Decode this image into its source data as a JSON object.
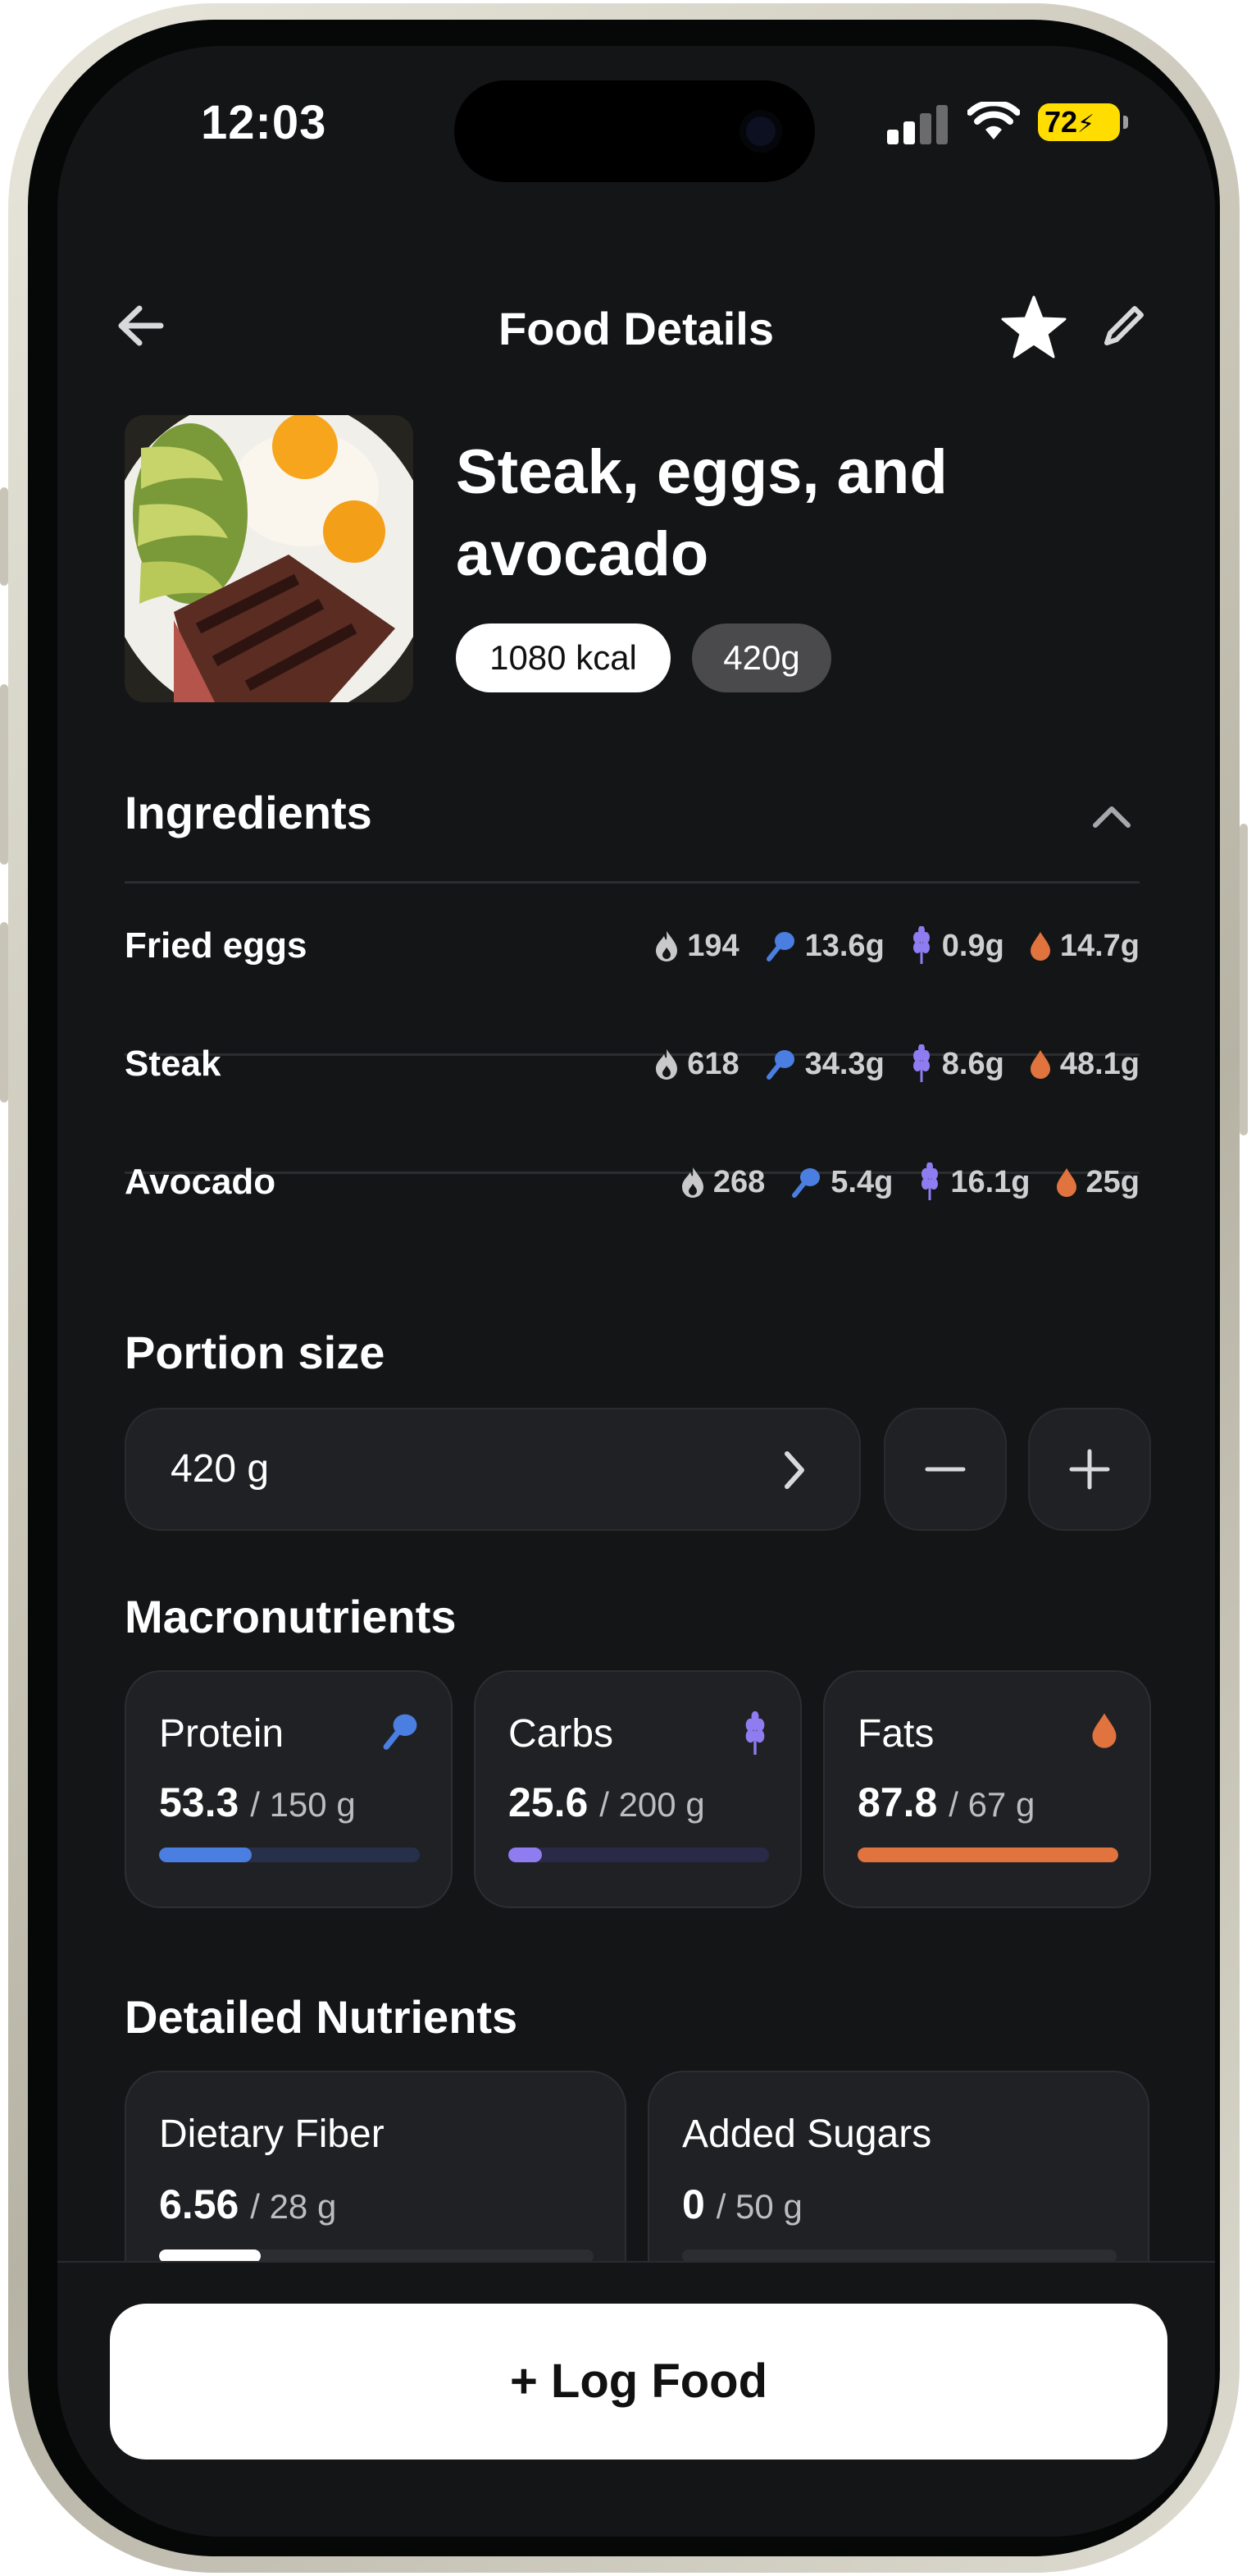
{
  "status": {
    "time": "12:03",
    "battery": "72"
  },
  "header": {
    "title": "Food Details"
  },
  "food": {
    "name": "Steak, eggs, and avocado",
    "kcal": "1080 kcal",
    "weight": "420g"
  },
  "ingredients": {
    "title": "Ingredients",
    "items": [
      {
        "name": "Fried eggs",
        "calories": "194",
        "protein": "13.6g",
        "carbs": "0.9g",
        "fat": "14.7g"
      },
      {
        "name": "Steak",
        "calories": "618",
        "protein": "34.3g",
        "carbs": "8.6g",
        "fat": "48.1g"
      },
      {
        "name": "Avocado",
        "calories": "268",
        "protein": "5.4g",
        "carbs": "16.1g",
        "fat": "25g"
      }
    ]
  },
  "portion": {
    "title": "Portion size",
    "value": "420 g"
  },
  "macros": {
    "title": "Macronutrients",
    "items": [
      {
        "label": "Protein",
        "value": "53.3",
        "goal": "/ 150 g",
        "progress": 0.355,
        "color": "#4a7ee0",
        "track": "#26304a",
        "icon": "drumstick-icon"
      },
      {
        "label": "Carbs",
        "value": "25.6",
        "goal": "/ 200 g",
        "progress": 0.128,
        "color": "#8e7cf0",
        "track": "#2a2947",
        "icon": "wheat-icon"
      },
      {
        "label": "Fats",
        "value": "87.8",
        "goal": "/ 67 g",
        "progress": 1.0,
        "color": "#e0733e",
        "track": "#3a2a22",
        "icon": "drop-icon"
      }
    ]
  },
  "nutrients": {
    "title": "Detailed Nutrients",
    "items": [
      {
        "label": "Dietary Fiber",
        "value": "6.56",
        "goal": "/ 28 g",
        "progress": 0.234,
        "color": "#ffffff"
      },
      {
        "label": "Added Sugars",
        "value": "0",
        "goal": "/ 50 g",
        "progress": 0,
        "color": "#ffffff"
      }
    ]
  },
  "actions": {
    "log_food": "+ Log Food"
  },
  "colors": {
    "background": "#141517",
    "card": "#202124",
    "protein": "#4a7ee0",
    "carbs": "#8e7cf0",
    "fat": "#e0733e"
  }
}
